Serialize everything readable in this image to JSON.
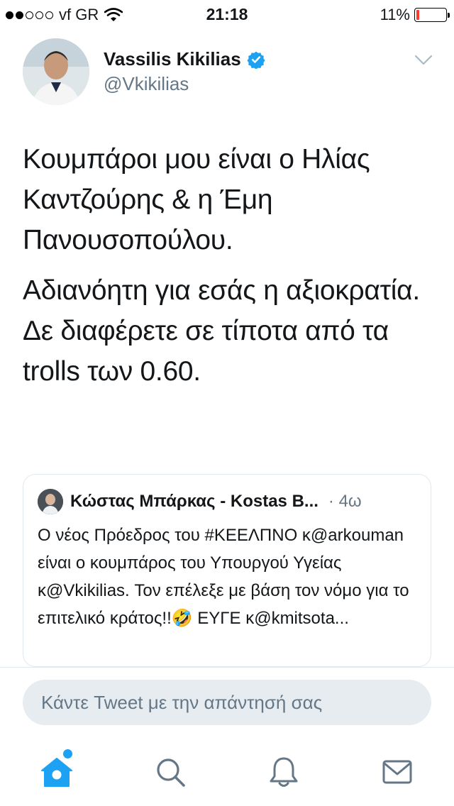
{
  "status_bar": {
    "carrier": "vf GR",
    "time": "21:18",
    "battery": "11%",
    "battery_level": 0.11,
    "signal_bars_filled": 2,
    "signal_bars_total": 5
  },
  "tweet": {
    "author_name": "Vassilis Kikilias",
    "author_handle": "@Vkikilias",
    "verified_icon": "verified-badge-icon",
    "paragraphs": [
      "Κουμπάροι μου είναι ο Ηλίας Καντζούρης & η Έμη Πανουσοπούλου.",
      "Αδιανόητη για εσάς η αξιοκρατία.",
      "Δε διαφέρετε σε τίποτα από τα trolls των 0.60."
    ]
  },
  "quoted_tweet": {
    "author": "Κώστας Μπάρκας - Kostas B...",
    "time": "· 4ω",
    "text": "Ο νέος Πρόεδρος του #ΚΕΕΛΠΝΟ κ@arkouman είναι ο κουμπάρος του Υπουργού Υγείας κ@Vkikilias. Τον επέλεξε με βάση τον νόμο για το επιτελικό κράτος!!🤣 ΕΥΓΕ κ@kmitsota..."
  },
  "reply": {
    "placeholder": "Κάντε Tweet με την απάντησή σας"
  },
  "tab_bar": {
    "items": [
      "home-icon",
      "search-icon",
      "notifications-icon",
      "messages-icon"
    ],
    "active": "home-icon"
  },
  "colors": {
    "accent": "#1da1f2",
    "text": "#14171a",
    "secondary_text": "#657786",
    "battery_low": "#ff3b30"
  }
}
